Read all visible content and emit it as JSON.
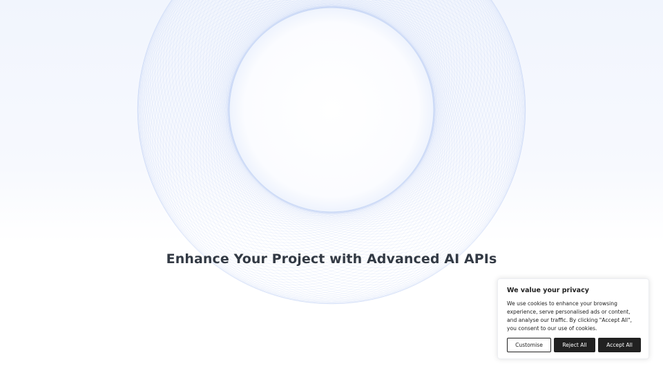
{
  "hero": {
    "title": "Enhance Your Project with Advanced AI APIs"
  },
  "cookie_banner": {
    "title": "We value your privacy",
    "text": "We use cookies to enhance your browsing experience, serve personalised ads or content, and analyse our traffic. By clicking \"Accept All\", you consent to our use of cookies.",
    "customise_label": "Customise",
    "reject_label": "Reject All",
    "accept_label": "Accept All"
  },
  "colors": {
    "accent_ring": "#9fb8ee",
    "button_dark": "#212121",
    "title_text": "#333a44"
  }
}
